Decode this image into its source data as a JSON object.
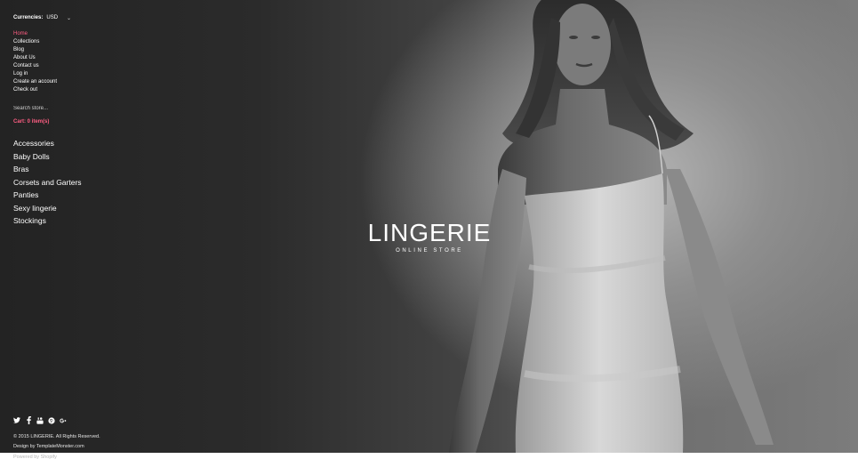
{
  "currency": {
    "label": "Currencies:",
    "selected": "USD"
  },
  "top_nav": [
    {
      "label": "Home",
      "active": true
    },
    {
      "label": "Collections",
      "active": false
    },
    {
      "label": "Blog",
      "active": false
    },
    {
      "label": "About Us",
      "active": false
    },
    {
      "label": "Contact us",
      "active": false
    },
    {
      "label": "Log in",
      "active": false
    },
    {
      "label": "Create an account",
      "active": false
    },
    {
      "label": "Check out",
      "active": false
    }
  ],
  "search": {
    "placeholder": "Search store..."
  },
  "cart": {
    "label": "Cart: 0 item(s)"
  },
  "categories": [
    "Accessories",
    "Baby Dolls",
    "Bras",
    "Corsets and Garters",
    "Panties",
    "Sexy lingerie",
    "Stockings"
  ],
  "logo": {
    "title": "LINGERIE",
    "subtitle": "ONLINE STORE"
  },
  "social_icons": [
    "twitter-icon",
    "facebook-icon",
    "youtube-icon",
    "pinterest-icon",
    "google-plus-icon"
  ],
  "footer": {
    "copyright": "© 2015 LINGERIE. All Rights Reserved.",
    "design_prefix": "Design by ",
    "design_link": "TemplateMonster.com",
    "powered": "Powered by Shopify"
  },
  "colors": {
    "accent": "#ff5e83",
    "text": "#ffffff"
  }
}
